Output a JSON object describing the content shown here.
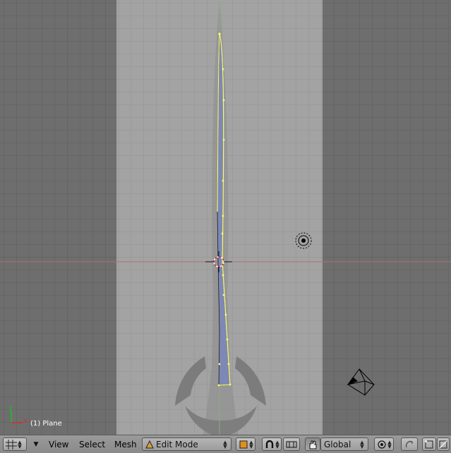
{
  "viewport": {
    "object_label": "(1) Plane",
    "axis_x_label": "X",
    "axis_z_label": "Z"
  },
  "header": {
    "editor_icon": "grid-icon",
    "menus": [
      "View",
      "Select",
      "Mesh"
    ],
    "mode": {
      "label": "Edit Mode",
      "icon": "triangle-mesh-icon"
    },
    "shading_icon": "orange-cube-icon",
    "pivot_icon": "magnet-icon",
    "orientation": {
      "label": "Global"
    },
    "proportional_icon": "circle-dot-icon"
  },
  "colors": {
    "viewport_bg": "#6e6e6e",
    "camera_view": "#a0a0a0",
    "grid_line": "#5e5e5e",
    "selected_edge": "#ffff66",
    "header_bg": "#929292"
  }
}
